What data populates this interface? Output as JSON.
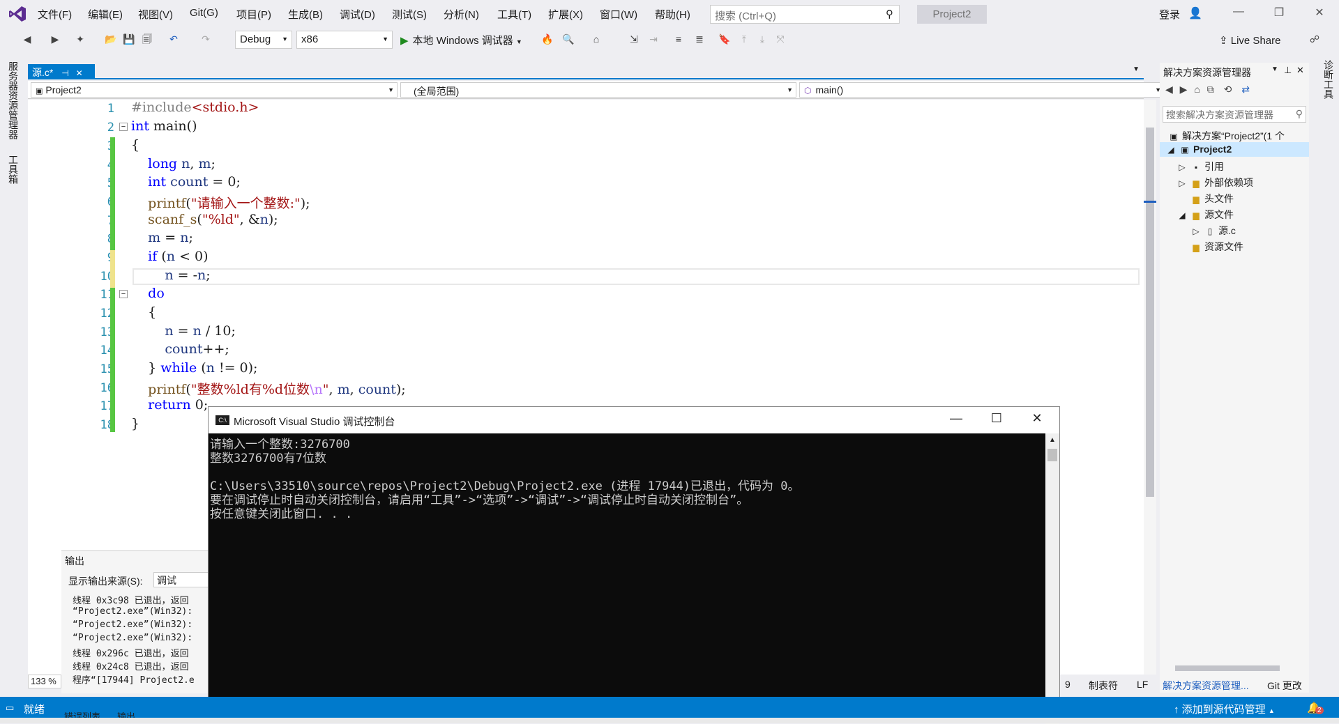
{
  "menu": {
    "items": [
      "文件(F)",
      "编辑(E)",
      "视图(V)",
      "Git(G)",
      "项目(P)",
      "生成(B)",
      "调试(D)",
      "测试(S)",
      "分析(N)",
      "工具(T)",
      "扩展(X)",
      "窗口(W)",
      "帮助(H)"
    ],
    "search_placeholder": "搜索 (Ctrl+Q)",
    "project_title": "Project2",
    "login": "登录"
  },
  "toolbar": {
    "config": "Debug",
    "platform": "x86",
    "run_label": "本地 Windows 调试器",
    "live_share": "Live Share"
  },
  "left_strip": {
    "tab1": "服务器资源管理器",
    "tab2": "工具箱"
  },
  "right_strip": {
    "tab1": "诊断工具"
  },
  "document": {
    "tab_label": "源.c*",
    "nav_project": "Project2",
    "nav_scope": "(全局范围)",
    "nav_function": "main()",
    "zoom": "133 %"
  },
  "code": {
    "line_numbers": [
      "1",
      "2",
      "3",
      "4",
      "5",
      "6",
      "7",
      "8",
      "9",
      "10",
      "11",
      "12",
      "13",
      "14",
      "15",
      "16",
      "17",
      "18"
    ]
  },
  "output": {
    "title": "输出",
    "source_label": "显示输出来源(S):",
    "source_value": "调试",
    "lines": [
      "线程 0x3c98 已退出，返回",
      "“Project2.exe”(Win32):",
      "“Project2.exe”(Win32):",
      "“Project2.exe”(Win32):",
      "线程 0x296c 已退出，返回",
      "线程 0x24c8 已退出，返回",
      "程序“[17944] Project2.e"
    ],
    "bottom_tabs": [
      "错误列表",
      "输出"
    ]
  },
  "console": {
    "title": "Microsoft Visual Studio 调试控制台",
    "icon_text": "C:\\",
    "lines": [
      "请输入一个整数:3276700",
      "整数3276700有7位数",
      "",
      "C:\\Users\\33510\\source\\repos\\Project2\\Debug\\Project2.exe (进程 17944)已退出，代码为 0。",
      "要在调试停止时自动关闭控制台，请启用“工具”->“选项”->“调试”->“调试停止时自动关闭控制台”。",
      "按任意键关闭此窗口. . ."
    ]
  },
  "solution_explorer": {
    "title": "解决方案资源管理器",
    "search_placeholder": "搜索解决方案资源管理器",
    "items": [
      {
        "label": "解决方案“Project2”(1 个"
      },
      {
        "label": "Project2"
      },
      {
        "label": "引用"
      },
      {
        "label": "外部依赖项"
      },
      {
        "label": "头文件"
      },
      {
        "label": "源文件"
      },
      {
        "label": "源.c"
      },
      {
        "label": "资源文件"
      }
    ],
    "bottom_tab_active": "解决方案资源管理...",
    "bottom_tab_other": "Git 更改"
  },
  "editor_status": {
    "col": "9",
    "eol_type": "制表符",
    "line_ending": "LF"
  },
  "status": {
    "text": "就绪",
    "source_control": "添加到源代码管理",
    "notification_count": "2"
  },
  "colors": {
    "accent": "#007acc",
    "keyword": "#0000ff",
    "string": "#a31515",
    "line_number": "#2b91af"
  }
}
